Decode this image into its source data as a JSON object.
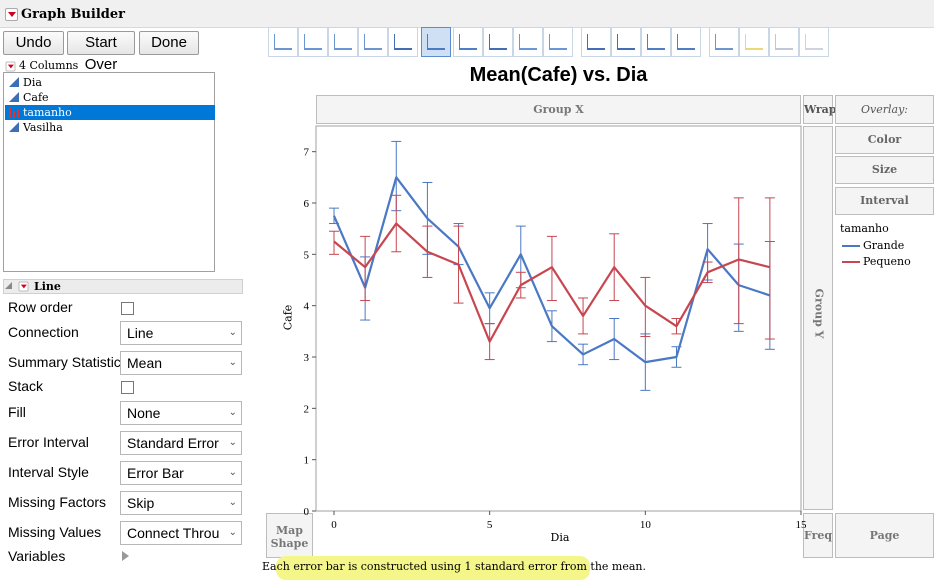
{
  "window": {
    "title": "Graph Builder"
  },
  "buttons": {
    "undo": "Undo",
    "start_over": "Start Over",
    "done": "Done"
  },
  "columns": {
    "count_label": "4 Columns",
    "items": [
      {
        "name": "Dia",
        "type": "continuous",
        "selected": false
      },
      {
        "name": "Cafe",
        "type": "continuous",
        "selected": false
      },
      {
        "name": "tamanho",
        "type": "nominal",
        "selected": true
      },
      {
        "name": "Vasilha",
        "type": "continuous",
        "selected": false
      }
    ]
  },
  "line_panel": {
    "title": "Line",
    "options": {
      "row_order": "Row order",
      "connection": "Connection",
      "connection_value": "Line",
      "summary_statistic": "Summary Statistic",
      "summary_statistic_value": "Mean",
      "stack": "Stack",
      "fill": "Fill",
      "fill_value": "None",
      "error_interval": "Error Interval",
      "error_interval_value": "Standard Error",
      "interval_style": "Interval Style",
      "interval_style_value": "Error Bar",
      "missing_factors": "Missing Factors",
      "missing_factors_value": "Skip",
      "missing_values": "Missing Values",
      "missing_values_value": "Connect Throu",
      "variables": "Variables"
    }
  },
  "toolbar": {
    "icons": [
      "points-icon",
      "smoother-icon",
      "line-of-fit-icon",
      "ellipse-icon",
      "contour-icon",
      "line-icon",
      "bar-icon",
      "area-icon",
      "box-plot-icon",
      "histogram-icon",
      "heatmap-icon",
      "pie-icon",
      "treemap-icon",
      "mosaic-icon",
      "caption-box-icon",
      "formula-icon",
      "map-shapes-icon",
      "parallel-icon"
    ],
    "selected": "line-icon"
  },
  "zones": {
    "group_x": "Group X",
    "group_y": "Group Y",
    "wrap": "Wrap",
    "overlay": "Overlay: tamanho",
    "color": "Color",
    "size": "Size",
    "interval": "Interval",
    "map_shape": "Map Shape",
    "freq": "Freq",
    "page": "Page"
  },
  "legend": {
    "title": "tamanho",
    "items": [
      {
        "label": "Grande",
        "color": "#4a78c4"
      },
      {
        "label": "Pequeno",
        "color": "#c7464f"
      }
    ]
  },
  "footnote": "Each error bar is constructed using 1 standard error from the mean.",
  "chart_data": {
    "type": "line",
    "title": "Mean(Cafe) vs. Dia",
    "xlabel": "Dia",
    "ylabel": "Cafe",
    "xlim": [
      0,
      15
    ],
    "ylim": [
      0,
      7.5
    ],
    "x_ticks": [
      0,
      5,
      10,
      15
    ],
    "y_ticks": [
      0,
      1,
      2,
      3,
      4,
      5,
      6,
      7
    ],
    "x": [
      0,
      1,
      2,
      3,
      4,
      5,
      6,
      7,
      8,
      9,
      10,
      11,
      12,
      13,
      14
    ],
    "series": [
      {
        "name": "Grande",
        "color": "#4a78c4",
        "values": [
          5.75,
          4.35,
          6.5,
          5.7,
          5.15,
          3.95,
          5.0,
          3.6,
          3.05,
          3.35,
          2.9,
          3.0,
          5.1,
          4.4,
          4.2
        ],
        "err_low": [
          5.6,
          3.72,
          5.85,
          5.0,
          4.8,
          3.65,
          4.35,
          3.3,
          2.85,
          2.95,
          2.35,
          2.8,
          4.5,
          3.5,
          3.15
        ],
        "err_high": [
          5.9,
          4.95,
          7.2,
          6.4,
          5.6,
          4.25,
          5.55,
          3.9,
          3.25,
          3.75,
          3.45,
          3.2,
          5.6,
          5.2,
          5.25
        ]
      },
      {
        "name": "Pequeno",
        "color": "#c7464f",
        "values": [
          5.25,
          4.75,
          5.6,
          5.05,
          4.8,
          3.3,
          4.4,
          4.75,
          3.8,
          4.75,
          4.0,
          3.6,
          4.65,
          4.9,
          4.75
        ],
        "err_low": [
          5.0,
          4.1,
          5.05,
          4.55,
          4.05,
          2.95,
          4.15,
          4.1,
          3.45,
          4.1,
          3.4,
          3.45,
          4.45,
          3.65,
          3.35
        ],
        "err_high": [
          5.45,
          5.35,
          6.15,
          5.55,
          5.55,
          3.65,
          4.65,
          5.35,
          4.15,
          5.4,
          4.55,
          3.75,
          4.85,
          6.1,
          6.1
        ]
      }
    ],
    "grid": false,
    "legend_position": "right"
  }
}
